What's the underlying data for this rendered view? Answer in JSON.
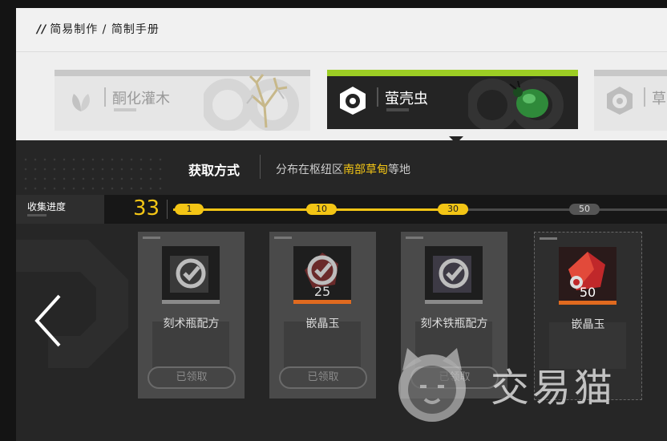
{
  "breadcrumb": {
    "mark": "//",
    "text": "简易制作 / 简制手册"
  },
  "carousel": {
    "items": [
      {
        "name": "酮化灌木",
        "active": false
      },
      {
        "name": "萤壳虫",
        "active": true
      },
      {
        "name": "草",
        "active": false
      }
    ]
  },
  "acquisition": {
    "label": "获取方式",
    "prefix": "分布在枢纽区",
    "highlight": "南部草甸",
    "suffix": "等地"
  },
  "progress": {
    "label": "收集进度",
    "count": "33",
    "current": 33,
    "milestones": [
      {
        "label": "1",
        "reached": true
      },
      {
        "label": "10",
        "reached": true
      },
      {
        "label": "30",
        "reached": true
      },
      {
        "label": "50",
        "reached": false
      }
    ]
  },
  "rewards": [
    {
      "title": "刻术瓶配方",
      "qty": "",
      "status": "已领取",
      "claimed": true
    },
    {
      "title": "嵌晶玉",
      "qty": "25",
      "status": "已领取",
      "claimed": true
    },
    {
      "title": "刻术铁瓶配方",
      "qty": "",
      "status": "已领取",
      "claimed": true
    },
    {
      "title": "嵌晶玉",
      "qty": "50",
      "status": "",
      "claimed": false
    }
  ],
  "watermark": {
    "text": "交易猫"
  },
  "colors": {
    "accent": "#f3c515",
    "active_strip": "#9ccd24",
    "background": "#262626"
  },
  "icons": [
    "leaf-icon",
    "hexagon-eye-icon",
    "checkmark-icon",
    "chevron-left-icon",
    "cat-logo-icon"
  ]
}
